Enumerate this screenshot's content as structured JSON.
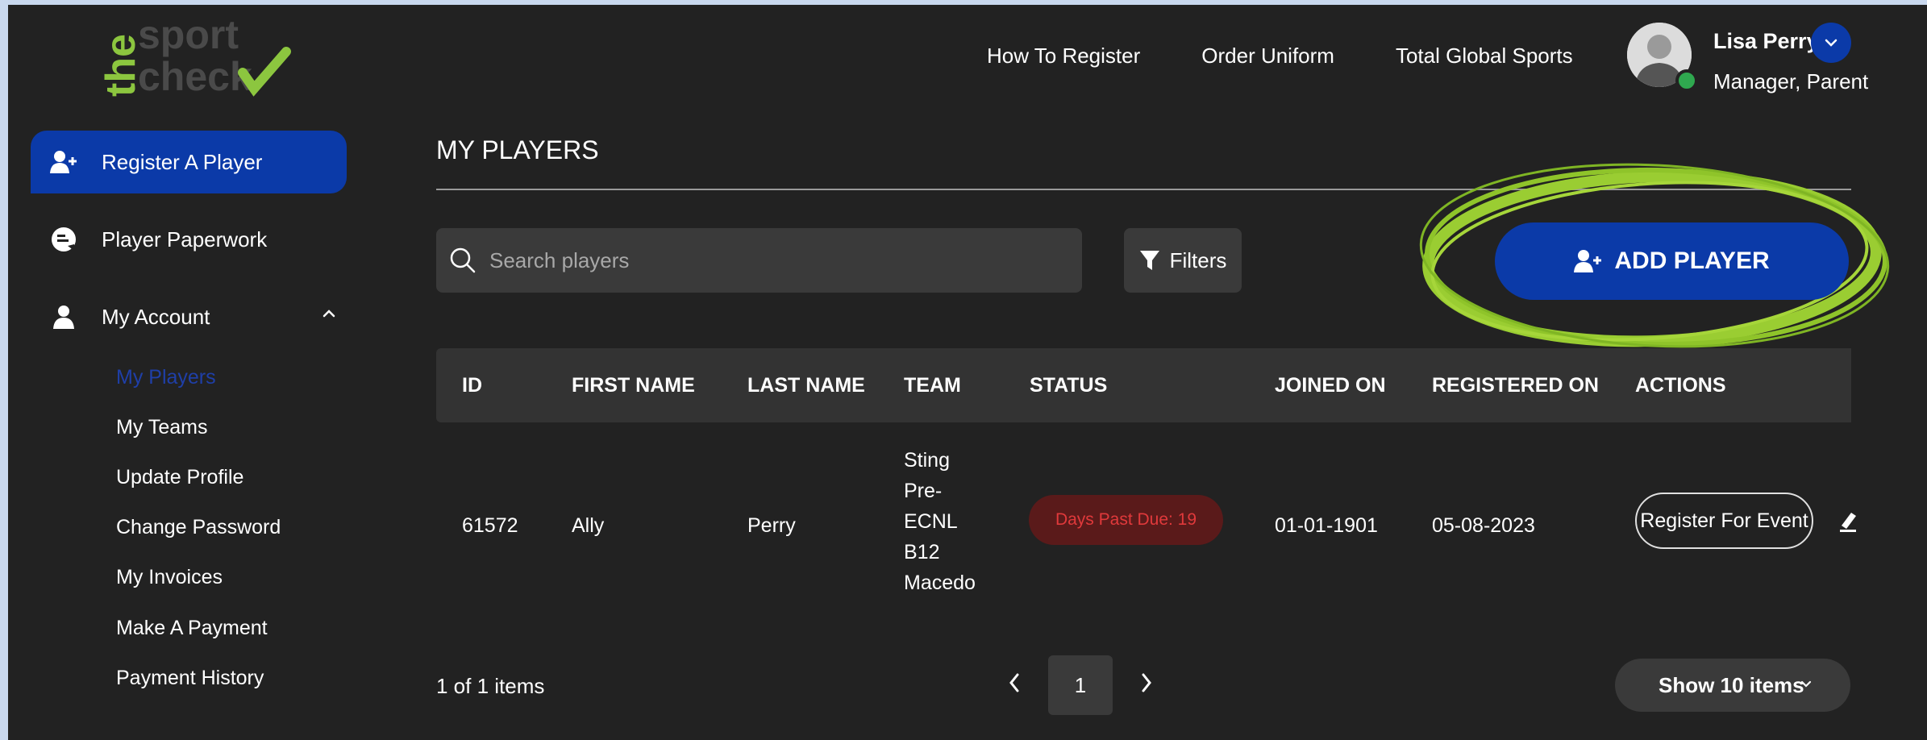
{
  "logo": {
    "word_the": "the",
    "word_sport": "sport",
    "word_check": "check",
    "brand_green": "#8cc63f",
    "brand_gray": "#4a4a4a"
  },
  "topnav": {
    "items": [
      "How To Register",
      "Order Uniform",
      "Total Global Sports"
    ]
  },
  "user": {
    "name": "Lisa Perry",
    "role": "Manager, Parent",
    "status": "online"
  },
  "sidebar": {
    "items": [
      {
        "label": "Register A Player",
        "icon": "user-plus-icon",
        "active": true
      },
      {
        "label": "Player Paperwork",
        "icon": "paperwork-icon",
        "active": false
      },
      {
        "label": "My Account",
        "icon": "user-icon",
        "expanded": true
      }
    ],
    "sub_items": [
      "My Players",
      "My Teams",
      "Update Profile",
      "Change Password",
      "My Invoices",
      "Make A Payment",
      "Payment History"
    ],
    "current_sub_item": "My Players"
  },
  "main": {
    "title": "MY PLAYERS",
    "search": {
      "placeholder": "Search players",
      "value": ""
    },
    "filters_label": "Filters",
    "add_player_label": "ADD PLAYER",
    "table": {
      "headers": [
        "ID",
        "FIRST NAME",
        "LAST NAME",
        "TEAM",
        "STATUS",
        "JOINED ON",
        "REGISTERED ON",
        "ACTIONS"
      ],
      "rows": [
        {
          "id": "61572",
          "first_name": "Ally",
          "last_name": "Perry",
          "team_lines": [
            "Sting",
            "Pre-",
            "ECNL",
            "B12",
            "Macedo"
          ],
          "status": "Days Past Due: 19",
          "joined_on": "01-01-1901",
          "registered_on": "05-08-2023",
          "action_label": "Register For Event"
        }
      ]
    },
    "pagination": {
      "summary": "1 of 1 items",
      "current_page": "1",
      "page_size_label": "Show 10 items"
    }
  },
  "colors": {
    "accent": "#0b3aa8",
    "background": "#222222",
    "panel": "#3a3a3a",
    "status_text": "#e0393b",
    "status_bg": "#5a1a1a",
    "highlight_scribble": "#9acd32"
  }
}
